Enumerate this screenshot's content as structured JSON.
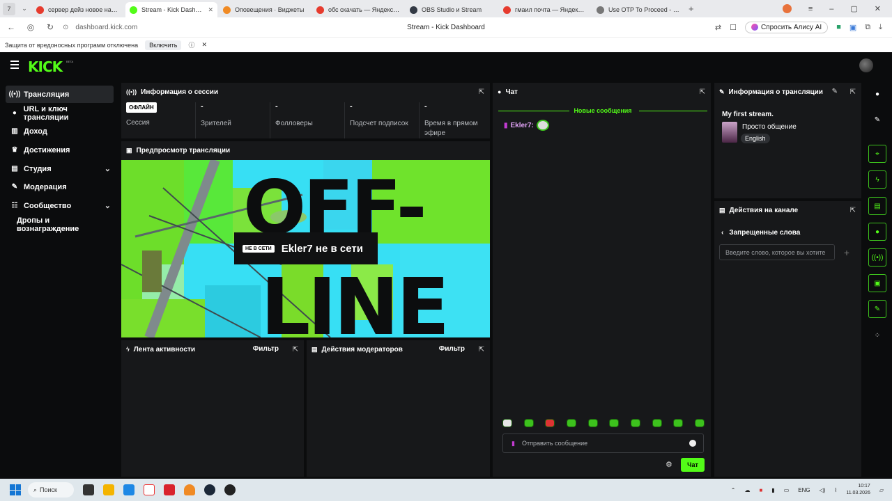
{
  "browser": {
    "tab_counter": "7",
    "tabs": [
      {
        "title": "сервер дейз новое начал",
        "color": "#e63b2e",
        "active": false
      },
      {
        "title": "Stream - Kick Dashboard",
        "color": "#53fc18",
        "active": true
      },
      {
        "title": "Оповещения · Виджеты",
        "color": "#f08a24",
        "active": false
      },
      {
        "title": "обс скачать — Яндекс: на",
        "color": "#e63b2e",
        "active": false
      },
      {
        "title": "OBS Studio и Stream",
        "color": "#333a45",
        "active": false
      },
      {
        "title": "гмаил почта — Яндекс: не",
        "color": "#e63b2e",
        "active": false
      },
      {
        "title": "Use OTP To Proceed - cele",
        "color": "#777777",
        "active": false
      }
    ],
    "url": "dashboard.kick.com",
    "page_title": "Stream - Kick Dashboard",
    "alice_label": "Спросить Алису AI",
    "protection_text": "Защита от вредоносных программ отключена",
    "protection_button": "Включить"
  },
  "kick": {
    "logo": "KICK",
    "beta": "BETA"
  },
  "sidebar": {
    "items": [
      {
        "label": "Трансляция",
        "icon": "((•))",
        "active": true,
        "chevron": false
      },
      {
        "label": "URL и ключ трансляции",
        "icon": "●",
        "active": false,
        "chevron": false
      },
      {
        "label": "Доход",
        "icon": "▥",
        "active": false,
        "chevron": false
      },
      {
        "label": "Достижения",
        "icon": "♛",
        "active": false,
        "chevron": false
      },
      {
        "label": "Студия",
        "icon": "▤",
        "active": false,
        "chevron": true
      },
      {
        "label": "Модерация",
        "icon": "✎",
        "active": false,
        "chevron": false
      },
      {
        "label": "Сообщество",
        "icon": "☷",
        "active": false,
        "chevron": true
      },
      {
        "label": "Дропы и вознаграждение",
        "icon": "",
        "active": false,
        "chevron": false
      }
    ]
  },
  "session": {
    "title": "Информация о сессии",
    "status_badge": "ОФЛАЙН",
    "stats": [
      {
        "value": "",
        "label": "Сессия"
      },
      {
        "value": "-",
        "label": "Зрителей"
      },
      {
        "value": "-",
        "label": "Фолловеры"
      },
      {
        "value": "-",
        "label": "Подсчет подписок"
      },
      {
        "value": "-",
        "label": "Время в прямом эфире"
      }
    ]
  },
  "preview": {
    "title": "Предпросмотр трансляции",
    "offline_tag": "НЕ В СЕТИ",
    "offline_text": "Ekler7 не в сети",
    "art_text_1": "OFF-",
    "art_text_2": "LINE"
  },
  "activity": {
    "title": "Лента активности",
    "filter": "Фильтр"
  },
  "mod_actions": {
    "title": "Действия модераторов",
    "filter": "Фильтр"
  },
  "chat": {
    "title": "Чат",
    "new_messages": "Новые сообщения",
    "message_user": "Ekler7:",
    "input_placeholder": "Отправить сообщение",
    "send_button": "Чат",
    "emote_count": 10
  },
  "stream_info": {
    "title": "Информация о трансляции",
    "stream_title": "My first stream.",
    "category": "Просто общение",
    "language": "English"
  },
  "channel_actions": {
    "title": "Действия на канале",
    "back_label": "Запрещенные слова",
    "word_placeholder": "Введите слово, которое вы хотите",
    "add_symbol": "+"
  },
  "taskbar": {
    "search_label": "Поиск",
    "lang": "ENG",
    "time": "10:17",
    "date": "11.03.2026"
  }
}
